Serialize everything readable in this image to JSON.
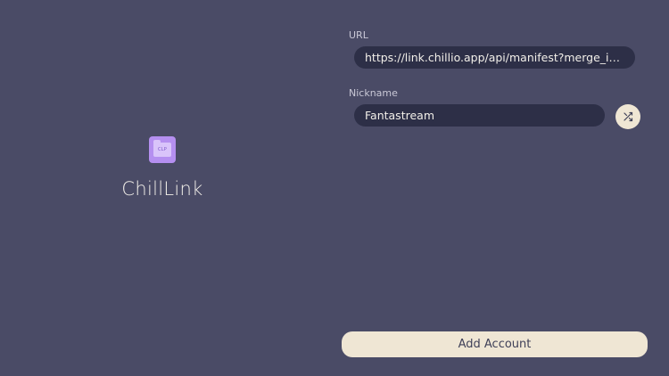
{
  "brand": {
    "icon_text": "CLP",
    "name": "ChillLink",
    "icon_color": "#b58ff0"
  },
  "form": {
    "url_label": "URL",
    "url_value": "https://link.chillio.app/api/manifest?merge_id=...",
    "nickname_label": "Nickname",
    "nickname_value": "Fantastream",
    "shuffle_icon": "shuffle-icon"
  },
  "actions": {
    "add_account_label": "Add Account"
  },
  "colors": {
    "background": "#4a4b66",
    "input_background": "#2d2f47",
    "button_background": "#efe6d4",
    "text": "#f2efe9"
  }
}
